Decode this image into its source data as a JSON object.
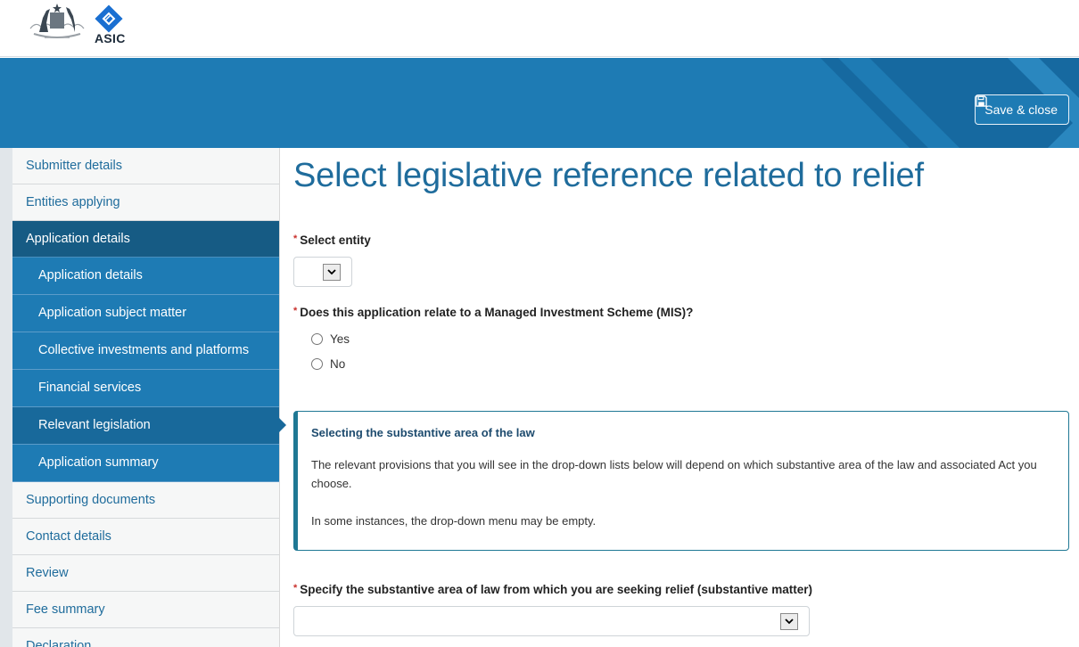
{
  "header": {
    "brand_text": "ASIC",
    "save_close_label": "Save & close",
    "colors": {
      "band": "#1e7bb4",
      "band_stripes": "#1669a0",
      "active_nav": "#165b84",
      "sub_nav": "#1e7bb4",
      "title": "#1f6c9c",
      "required": "#c9302c"
    }
  },
  "sidebar": {
    "items": [
      {
        "label": "Submitter details",
        "state": "normal"
      },
      {
        "label": "Entities applying",
        "state": "normal"
      },
      {
        "label": "Application details",
        "state": "active-parent"
      },
      {
        "label": "Application details",
        "state": "sub"
      },
      {
        "label": "Application subject matter",
        "state": "sub"
      },
      {
        "label": "Collective investments and platforms",
        "state": "sub"
      },
      {
        "label": "Financial services",
        "state": "sub"
      },
      {
        "label": "Relevant legislation",
        "state": "sub-current"
      },
      {
        "label": "Application summary",
        "state": "sub"
      },
      {
        "label": "Supporting documents",
        "state": "normal"
      },
      {
        "label": "Contact details",
        "state": "normal"
      },
      {
        "label": "Review",
        "state": "normal"
      },
      {
        "label": "Fee summary",
        "state": "normal"
      },
      {
        "label": "Declaration",
        "state": "normal"
      }
    ]
  },
  "main": {
    "title": "Select legislative reference related to relief",
    "required_marker": "*",
    "select_entity": {
      "label": "Select entity",
      "value": ""
    },
    "mis_question": {
      "label": "Does this application relate to a Managed Investment Scheme (MIS)?",
      "options": [
        "Yes",
        "No"
      ],
      "selected": null
    },
    "info_box": {
      "title": "Selecting the substantive area of the law",
      "paragraphs": [
        "The relevant provisions that you will see in the drop-down lists below will depend on which substantive area of the law and associated Act you choose.",
        "In some instances, the drop-down menu may be empty."
      ]
    },
    "substantive_area": {
      "label": "Specify the substantive area of law from which you are seeking relief (substantive matter)",
      "value": ""
    }
  }
}
